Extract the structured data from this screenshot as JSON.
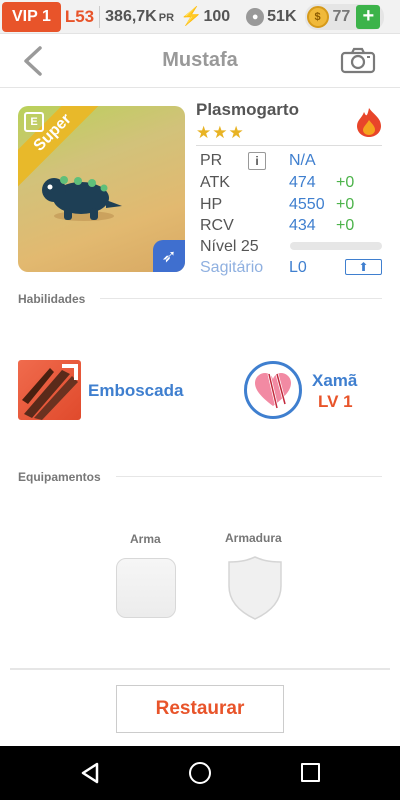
{
  "status_bar": {
    "vip": "VIP 1",
    "level": "L53",
    "pr_value": "386,7K",
    "pr_unit": "PR",
    "energy": "100",
    "food": "51K",
    "coins": "77",
    "plus": "+"
  },
  "header": {
    "title": "Mustafa"
  },
  "monster": {
    "name": "Plasmogarto",
    "rarity": "Super",
    "badge": "E",
    "stars": "★★★",
    "stats": [
      {
        "label": "PR",
        "value": "N/A",
        "bonus": ""
      },
      {
        "label": "ATK",
        "value": "474",
        "bonus": "+0"
      },
      {
        "label": "HP",
        "value": "4550",
        "bonus": "+0"
      },
      {
        "label": "RCV",
        "value": "434",
        "bonus": "+0"
      }
    ],
    "info_icon": "i",
    "level_label": "Nível 25",
    "level_progress": 0,
    "sign": "Sagitário",
    "sign_level": "L0",
    "up_arrow": "⬆"
  },
  "skills": {
    "section_title": "Habilidades",
    "skill_name": "Emboscada",
    "class_name": "Xamã",
    "class_level": "LV 1"
  },
  "equipment": {
    "section_title": "Equipamentos",
    "weapon_label": "Arma",
    "armor_label": "Armadura"
  },
  "actions": {
    "restore_label": "Restaurar"
  },
  "colors": {
    "accent_orange": "#e8542a",
    "stat_blue": "#3f7fcf",
    "bonus_green": "#4cb34a",
    "star_gold": "#e8b324"
  }
}
